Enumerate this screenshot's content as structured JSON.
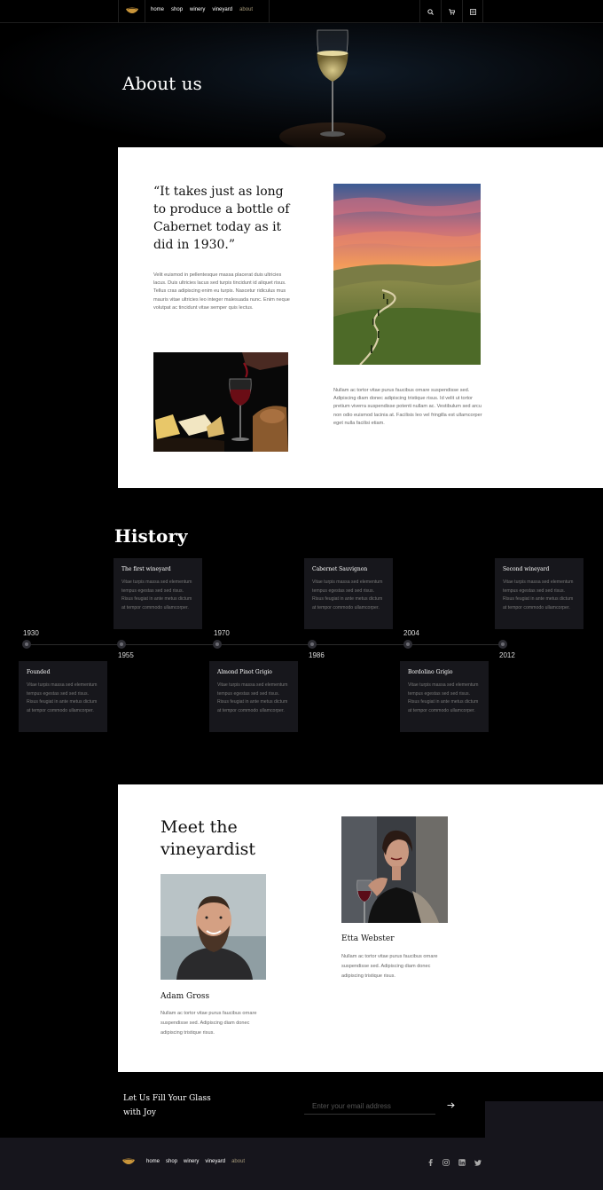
{
  "nav": {
    "links": [
      "home",
      "shop",
      "winery",
      "vineyard",
      "about"
    ],
    "active": "about",
    "icons": [
      "search-icon",
      "cart-icon",
      "menu-icon"
    ]
  },
  "hero": {
    "title": "About us"
  },
  "about": {
    "quote": "“It takes just as long to produce a bottle of Cabernet today as it did in 1930.”",
    "paragraph1": "Velit euismod in pellentesque massa placerat duis ultricies lacus. Duis ultricies lacus sed turpis tincidunt id aliquet risus. Tellus cras adipiscing enim eu turpis. Nascetur ridiculus mus mauris vitae ultricies leo integer malesuada nunc. Enim neque volutpat ac tincidunt vitae semper quis lectus.",
    "paragraph2": "Nullam ac tortor vitae purus faucibus ornare suspendisse sed. Adipiscing diam donec adipiscing tristique risus. Id velit ut tortor pretium viverra suspendisse potenti nullam ac. Vestibulum sed arcu non odio euismod lacinia at. Facilisis leo vel fringilla est ullamcorper eget nulla facilisi etiam."
  },
  "history": {
    "title": "History",
    "events": [
      {
        "year": "1930",
        "title": "Founded",
        "body": "Vitae turpis massa sed elementum tempus egestas sed sed risus. Risus feugiat in ante metus dictum at tempor commodo ullamcorper."
      },
      {
        "year": "1955",
        "title": "The first wineyard",
        "body": "Vitae turpis massa sed elementum tempus egestas sed sed risus. Risus feugiat in ante metus dictum at tempor commodo ullamcorper."
      },
      {
        "year": "1970",
        "title": "Almond Pinot Grigio",
        "body": "Vitae turpis massa sed elementum tempus egestas sed sed risus. Risus feugiat in ante metus dictum at tempor commodo ullamcorper."
      },
      {
        "year": "1986",
        "title": "Cabernet Sauvignon",
        "body": "Vitae turpis massa sed elementum tempus egestas sed sed risus. Risus feugiat in ante metus dictum at tempor commodo ullamcorper."
      },
      {
        "year": "2004",
        "title": "Bordolino Grigio",
        "body": "Vitae turpis massa sed elementum tempus egestas sed sed risus. Risus feugiat in ante metus dictum at tempor commodo ullamcorper."
      },
      {
        "year": "2012",
        "title": "Second wineyard",
        "body": "Vitae turpis massa sed elementum tempus egestas sed sed risus. Risus feugiat in ante metus dictum at tempor commodo ullamcorper."
      }
    ]
  },
  "meet": {
    "title_line1": "Meet the",
    "title_line2": "vineyardist",
    "people": [
      {
        "name": "Adam Gross",
        "desc": "Nullam ac tortor vitae purus faucibus ornare suspendisse sed. Adipiscing diam donec adipiscing tristique risus."
      },
      {
        "name": "Etta Webster",
        "desc": "Nullam ac tortor vitae purus faucibus ornare suspendisse sed. Adipiscing diam donec adipiscing tristique risus."
      }
    ]
  },
  "newsletter": {
    "title_line1": "Let Us Fill Your Glass",
    "title_line2": "with Joy",
    "placeholder": "Enter your email address"
  },
  "footer": {
    "links": [
      "home",
      "shop",
      "winery",
      "vineyard",
      "about"
    ],
    "active": "about",
    "social": [
      "facebook-icon",
      "instagram-icon",
      "linkedin-icon",
      "twitter-icon"
    ]
  },
  "colors": {
    "accent": "#a79a7a",
    "logo_gold": "#c9953a",
    "card_bg": "#17171c",
    "footer_bg": "#16151c"
  }
}
